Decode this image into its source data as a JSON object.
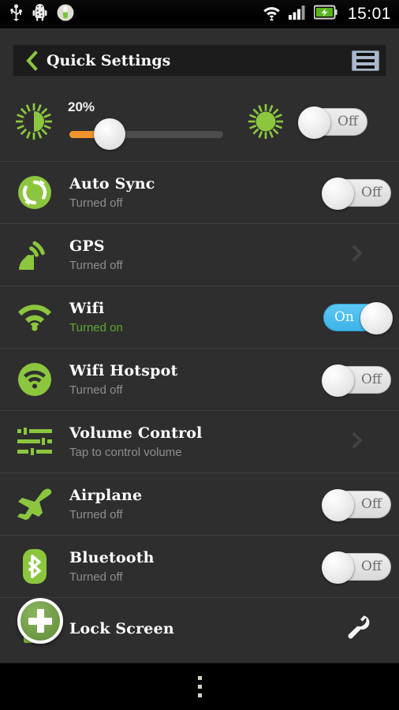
{
  "status_bar": {
    "time": "15:01",
    "left_icons": [
      "usb-icon",
      "android-debug-icon",
      "capsule-icon"
    ],
    "right_icons": [
      "wifi-signal-icon",
      "cellular-signal-icon",
      "battery-charging-icon"
    ]
  },
  "title_bar": {
    "back_icon": "back-chevron-icon",
    "title": "Quick Settings",
    "menu_icon": "hamburger-menu-icon"
  },
  "brightness": {
    "low_icon": "brightness-low-icon",
    "high_icon": "brightness-high-icon",
    "percent_label": "20%",
    "value": 20,
    "auto_toggle": {
      "state": "off",
      "label": "Off"
    }
  },
  "rows": [
    {
      "icon": "auto-sync-icon",
      "title": "Auto Sync",
      "subtitle": "Turned off",
      "subtitle_state": "off",
      "control": "toggle",
      "toggle": {
        "state": "off",
        "label": "Off"
      }
    },
    {
      "icon": "gps-satellite-icon",
      "title": "GPS",
      "subtitle": "Turned off",
      "subtitle_state": "off",
      "control": "chevron",
      "toggle": null
    },
    {
      "icon": "wifi-icon",
      "title": "Wifi",
      "subtitle": "Turned on",
      "subtitle_state": "on",
      "control": "toggle",
      "toggle": {
        "state": "on",
        "label": "On"
      }
    },
    {
      "icon": "wifi-hotspot-icon",
      "title": "Wifi Hotspot",
      "subtitle": "Turned off",
      "subtitle_state": "off",
      "control": "toggle",
      "toggle": {
        "state": "off",
        "label": "Off"
      }
    },
    {
      "icon": "volume-sliders-icon",
      "title": "Volume Control",
      "subtitle": "Tap to control volume",
      "subtitle_state": "off",
      "control": "chevron",
      "toggle": null
    },
    {
      "icon": "airplane-icon",
      "title": "Airplane",
      "subtitle": "Turned off",
      "subtitle_state": "off",
      "control": "toggle",
      "toggle": {
        "state": "off",
        "label": "Off"
      }
    },
    {
      "icon": "bluetooth-icon",
      "title": "Bluetooth",
      "subtitle": "Turned off",
      "subtitle_state": "off",
      "control": "toggle",
      "toggle": {
        "state": "off",
        "label": "Off"
      }
    },
    {
      "icon": "lock-screen-icon",
      "title": "Lock Screen",
      "subtitle": "",
      "subtitle_state": "off",
      "control": "wrench",
      "toggle": null
    }
  ],
  "add_button": {
    "icon": "add-plus-icon"
  },
  "nav_bar": {
    "menu_icon": "overflow-menu-icon"
  },
  "colors": {
    "accent_green": "#8cc63f",
    "toggle_on_blue": "#4dbdf0",
    "slider_orange": "#f0932b",
    "background": "#2e2e2e",
    "title_bar": "#1c1c1c",
    "subtitle_gray": "#8e8e8e",
    "subtitle_on_green": "#5fa832"
  }
}
